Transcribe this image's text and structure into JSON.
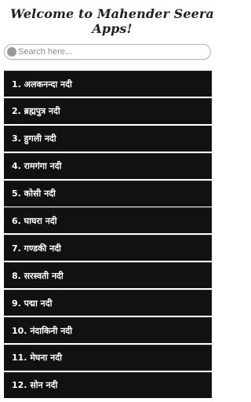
{
  "header": {
    "title": "Welcome to Mahender Seera Apps!"
  },
  "search": {
    "placeholder": "Search here..."
  },
  "rivers": [
    "1. अलकनन्दा नदी",
    "2. ब्रह्मपुत्र नदी",
    "3. हुगली नदी",
    "4. रामगंगा नदी",
    "5. कोसी नदी",
    "6. घाघरा नदी",
    "7. गण्डकी नदी",
    "8. सरस्वती नदी",
    "9. पद्मा नदी",
    "10. नंदाकिनी नदी",
    "11. मेघना नदी",
    "12. सोन नदी"
  ]
}
